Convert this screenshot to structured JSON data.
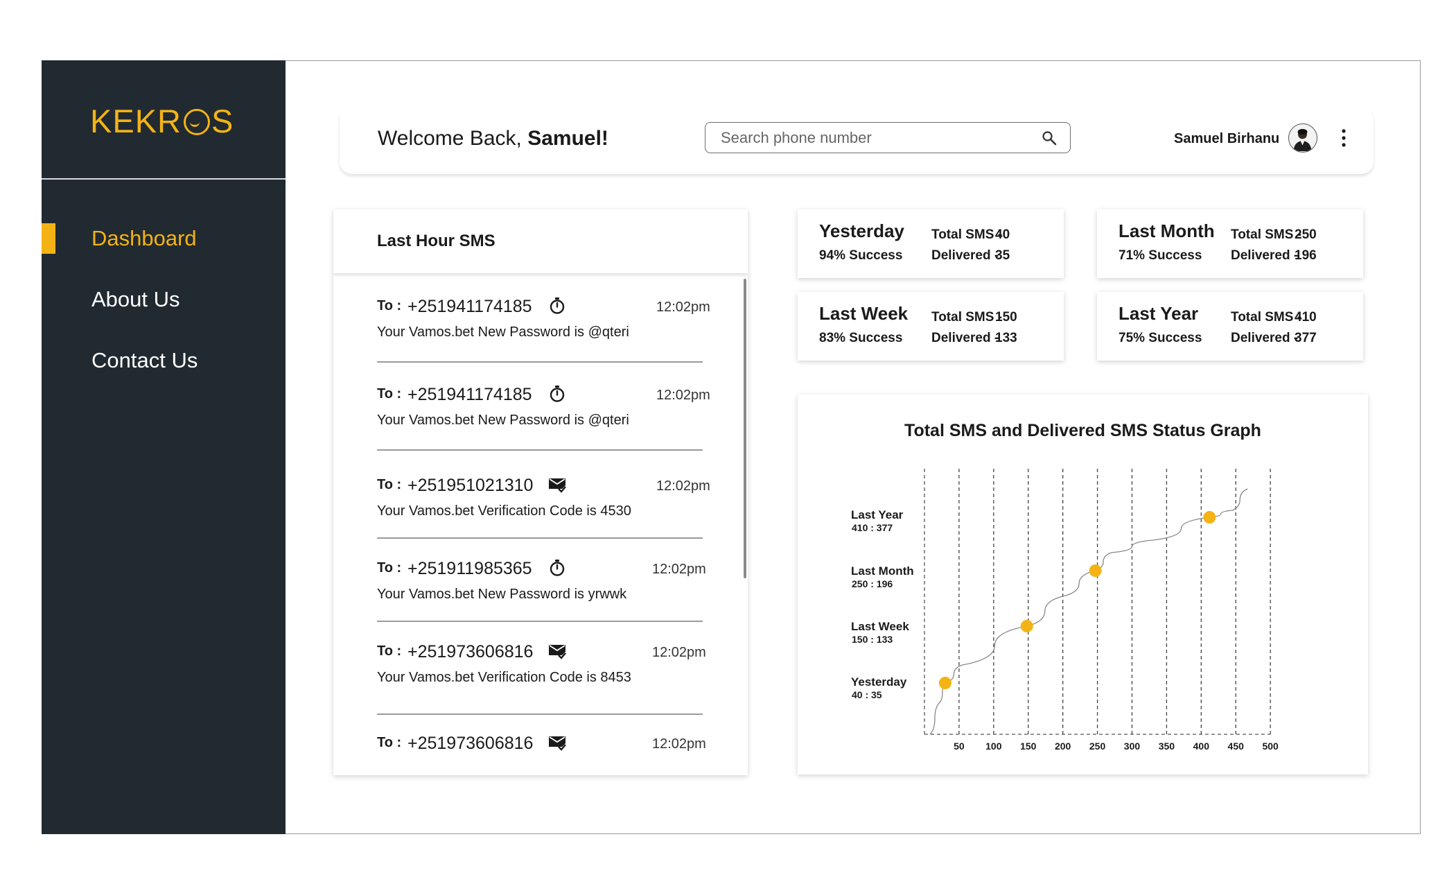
{
  "brand": {
    "name_left": "KEKR",
    "name_right": "S"
  },
  "sidebar": {
    "items": [
      {
        "label": "Dashboard",
        "active": true
      },
      {
        "label": "About Us",
        "active": false
      },
      {
        "label": "Contact Us",
        "active": false
      }
    ]
  },
  "header": {
    "welcome_prefix": "Welcome Back,",
    "welcome_name": "Samuel!",
    "search_placeholder": "Search phone number",
    "user_name": "Samuel Birhanu"
  },
  "last_hour": {
    "title": "Last Hour SMS",
    "to_label": "To :",
    "messages": [
      {
        "number": "+251941174185",
        "status_icon": "timer-icon",
        "time": "12:02pm",
        "text": "Your Vamos.bet New Password is @qteri"
      },
      {
        "number": "+251941174185",
        "status_icon": "timer-icon",
        "time": "12:02pm",
        "text": "Your Vamos.bet New Password is @qteri"
      },
      {
        "number": "+251951021310",
        "status_icon": "mail-check-icon",
        "time": "12:02pm",
        "text": "Your Vamos.bet Verification Code is 4530"
      },
      {
        "number": "+251911985365",
        "status_icon": "timer-icon",
        "time": "12:02pm",
        "text": "Your Vamos.bet New Password is yrwwk"
      },
      {
        "number": "+251973606816",
        "status_icon": "mail-check-icon",
        "time": "12:02pm",
        "text": "Your Vamos.bet Verification Code is 8453"
      },
      {
        "number": "+251973606816",
        "status_icon": "mail-check-icon",
        "time": "12:02pm",
        "text": ""
      }
    ]
  },
  "stats": [
    {
      "period": "Yesterday",
      "success": "94% Success",
      "total_label": "Total SMS -",
      "total": "40",
      "delivered_label": "Delivered  -",
      "delivered": "35"
    },
    {
      "period": "Last Month",
      "success": "71% Success",
      "total_label": "Total SMS -",
      "total": "250",
      "delivered_label": "Delivered  -",
      "delivered": "196"
    },
    {
      "period": "Last Week",
      "success": "83% Success",
      "total_label": "Total SMS -",
      "total": "150",
      "delivered_label": "Delivered  -",
      "delivered": "133"
    },
    {
      "period": "Last Year",
      "success": "75% Success",
      "total_label": "Total SMS -",
      "total": "410",
      "delivered_label": "Delivered  -",
      "delivered": "377"
    }
  ],
  "chart_data": {
    "type": "line",
    "title": "Total SMS and Delivered SMS Status Graph",
    "x_ticks": [
      50,
      100,
      150,
      200,
      250,
      300,
      350,
      400,
      450,
      500
    ],
    "xlim": [
      0,
      500
    ],
    "grid": "vertical dashed",
    "categories": [
      {
        "name": "Last Year",
        "ratio": "410 : 377"
      },
      {
        "name": "Last Month",
        "ratio": "250 : 196"
      },
      {
        "name": "Last Week",
        "ratio": "150 : 133"
      },
      {
        "name": "Yesterday",
        "ratio": "40 : 35"
      }
    ],
    "points": [
      {
        "x": 30,
        "category": "Yesterday"
      },
      {
        "x": 148,
        "category": "Last Week"
      },
      {
        "x": 247,
        "category": "Last Month"
      },
      {
        "x": 412,
        "category": "Last Year"
      }
    ],
    "line_color": "#888888",
    "marker_color": "#f4b315"
  },
  "colors": {
    "accent": "#f4b315",
    "sidebar_bg": "#212a31"
  }
}
